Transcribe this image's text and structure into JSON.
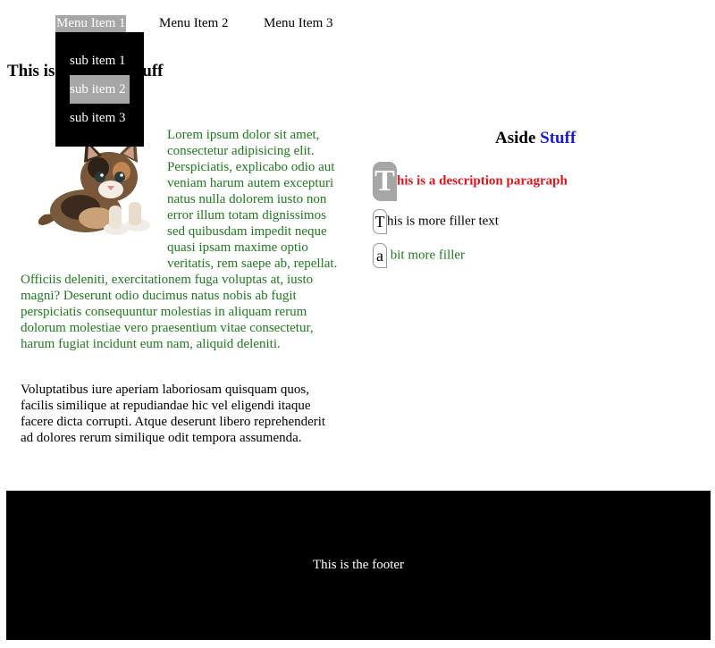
{
  "nav": {
    "items": [
      "Menu Item 1",
      "Menu Item 2",
      "Menu Item 3"
    ],
    "submenu": [
      "sub item 1",
      "sub item 2",
      "sub item 3"
    ]
  },
  "heading": {
    "start": "This is",
    "end": "e stuff"
  },
  "main": {
    "para1": "Lorem ipsum dolor sit amet, consectetur adipisicing elit. Perspiciatis, explicabo odio aut veniam harum autem excepturi natus nulla dolorem iusto non error illum totam dignissimos sed quibusdam impedit neque quasi ipsam maxime optio veritatis, rem saepe ab, repellat. Officiis deleniti, exercitationem fuga voluptas at, iusto magni? Deserunt odio ducimus natus nobis ab fugit perspiciatis consequuntur molestias in aliquam rerum dolorum molestiae vero praesentium vitae consectetur, harum fugiat incidunt eum nam, aliquid deleniti.",
    "para2": "Voluptatibus iure aperiam laboriosam quisquam quos, facilis similique at repudiandae hic vel eligendi itaque facere dicta corrupti. Atque deserunt libero reprehenderit ad dolores rerum similique odit tempora assumenda."
  },
  "aside": {
    "title_part1": "Aside",
    "title_part2": "Stuff",
    "desc1_cap": "T",
    "desc1_rest": "his is a description paragraph",
    "desc2_cap": "T",
    "desc2_rest": "his is more filler text",
    "desc3_cap": "a",
    "desc3_rest": " bit more filler"
  },
  "footer": {
    "text": "This is the footer"
  },
  "colors": {
    "accent_gray": "#a6a6a6",
    "green_text": "#1f7a1f",
    "red_text": "#e0141e",
    "blue_text": "#1a1ad6"
  },
  "icons": {
    "kitten": "kitten-photo"
  }
}
